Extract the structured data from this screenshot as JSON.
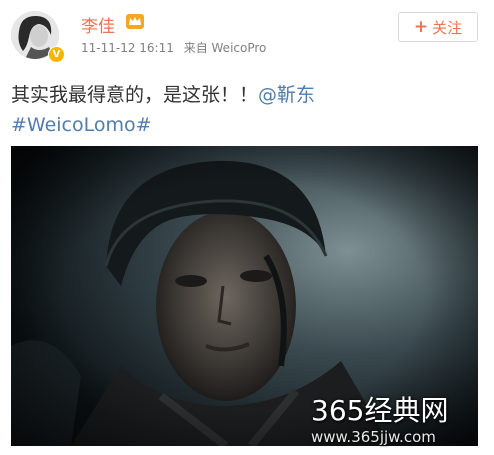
{
  "post": {
    "username": "李佳",
    "timestamp": "11-11-12 16:11",
    "source": "来自 WeicoPro",
    "verified_badge": "V",
    "follow_label": "关注",
    "follow_icon": "+",
    "text": {
      "line1": "其实我最得意的，是这张！！",
      "mention": "@靳东",
      "hashtag": "#WeicoLomo#"
    },
    "photo": {
      "description_icon": "soldier-helmet-photo"
    }
  },
  "watermark": {
    "title": "365经典网",
    "url": "www.365jjw.com"
  },
  "colors": {
    "username": "#eb7350",
    "link": "#507daf",
    "meta": "#808080",
    "text": "#333333"
  }
}
